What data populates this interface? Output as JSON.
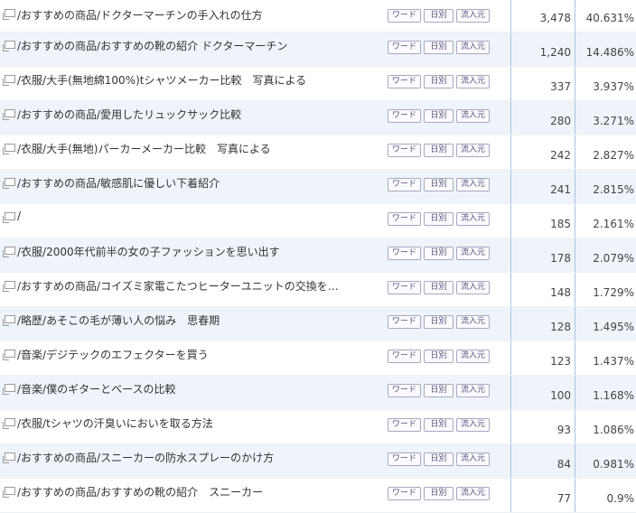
{
  "buttons": {
    "word": "ワード",
    "daily": "日別",
    "source": "流入元"
  },
  "rows": [
    {
      "title": "/おすすめの商品/ドクターマーチンの手入れの仕方",
      "count": "3,478",
      "percent": "40.631%"
    },
    {
      "title": "/おすすめの商品/おすすめの靴の紹介 ドクターマーチン",
      "count": "1,240",
      "percent": "14.486%"
    },
    {
      "title": "/衣服/大手(無地綿100%)tシャツメーカー比較　写真による",
      "count": "337",
      "percent": "3.937%"
    },
    {
      "title": "/おすすめの商品/愛用したリュックサック比較",
      "count": "280",
      "percent": "3.271%"
    },
    {
      "title": "/衣服/大手(無地)パーカーメーカー比較　写真による",
      "count": "242",
      "percent": "2.827%"
    },
    {
      "title": "/おすすめの商品/敏感肌に優しい下着紹介",
      "count": "241",
      "percent": "2.815%"
    },
    {
      "title": "/",
      "count": "185",
      "percent": "2.161%"
    },
    {
      "title": "/衣服/2000年代前半の女の子ファッションを思い出す",
      "count": "178",
      "percent": "2.079%"
    },
    {
      "title": "/おすすめの商品/コイズミ家電こたつヒーターユニットの交換を…",
      "count": "148",
      "percent": "1.729%"
    },
    {
      "title": "/略歴/あそこの毛が薄い人の悩み　思春期",
      "count": "128",
      "percent": "1.495%"
    },
    {
      "title": "/音楽/デジテックのエフェクターを買う",
      "count": "123",
      "percent": "1.437%"
    },
    {
      "title": "/音楽/僕のギターとベースの比較",
      "count": "100",
      "percent": "1.168%"
    },
    {
      "title": "/衣服/tシャツの汗臭いにおいを取る方法",
      "count": "93",
      "percent": "1.086%"
    },
    {
      "title": "/おすすめの商品/スニーカーの防水スプレーのかけ方",
      "count": "84",
      "percent": "0.981%"
    },
    {
      "title": "/おすすめの商品/おすすめの靴の紹介　スニーカー",
      "count": "77",
      "percent": "0.9%"
    }
  ]
}
